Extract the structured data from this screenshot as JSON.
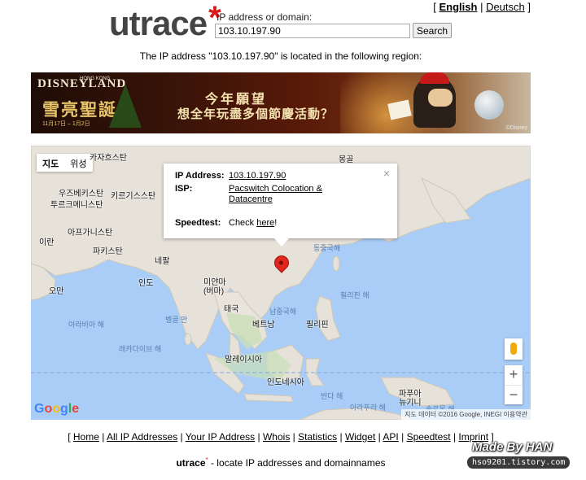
{
  "header": {
    "lang_open": "[ ",
    "lang_english": "English",
    "lang_sep": " | ",
    "lang_deutsch": "Deutsch",
    "lang_close": " ]",
    "logo": "utrace",
    "logo_star": "*",
    "ip_label": "IP address or domain:",
    "ip_value": "103.10.197.90",
    "search_button": "Search"
  },
  "located_text": "The IP address \"103.10.197.90\" is located in the following region:",
  "banner": {
    "brand": "DISNEYLAND",
    "brand_region": "HONG KONG",
    "title_left": "雪亮聖誕",
    "dates": "11月17日 – 1月2日",
    "line1": "今年願望",
    "line2": "想全年玩盡多個節慶活動？",
    "copyright": "©Disney"
  },
  "map": {
    "tab_map": "지도",
    "tab_satellite": "위성",
    "labels": [
      {
        "text": "카자흐스탄"
      },
      {
        "text": "몽골"
      },
      {
        "text": "우즈베키스탄"
      },
      {
        "text": "키르기스스탄"
      },
      {
        "text": "투르크메니스탄"
      },
      {
        "text": "아프가니스탄"
      },
      {
        "text": "이란"
      },
      {
        "text": "파키스탄"
      },
      {
        "text": "네팔"
      },
      {
        "text": "인도"
      },
      {
        "text": "오만"
      },
      {
        "text": "미얀마\n(버마)"
      },
      {
        "text": "태국"
      },
      {
        "text": "베트남"
      },
      {
        "text": "필리핀"
      },
      {
        "text": "말레이시아"
      },
      {
        "text": "인도네시아"
      },
      {
        "text": "파푸아\n뉴기니"
      }
    ],
    "seas": [
      {
        "text": "동중국해"
      },
      {
        "text": "필리핀 해"
      },
      {
        "text": "남중국해"
      },
      {
        "text": "벵골 만"
      },
      {
        "text": "아라비아 해"
      },
      {
        "text": "래카다이브 해"
      },
      {
        "text": "반다 해"
      },
      {
        "text": "아라푸라 해"
      },
      {
        "text": "솔로몬 해"
      }
    ],
    "popup": {
      "ip_label": "IP Address:",
      "ip_value": "103.10.197.90",
      "isp_label": "ISP:",
      "isp_value": "Pacswitch Colocation & Datacentre",
      "speedtest_label": "Speedtest:",
      "speedtest_prefix": "Check ",
      "speedtest_link": "here",
      "speedtest_suffix": "!",
      "close": "×"
    },
    "zoom_in": "+",
    "zoom_out": "−",
    "attribution": "지도 데이터 ©2016 Google, INEGI   이용약관"
  },
  "footer": {
    "open": "[ ",
    "links": [
      "Home",
      "All IP Addresses",
      "Your IP Address",
      "Whois",
      "Statistics",
      "Widget",
      "API",
      "Speedtest",
      "Imprint"
    ],
    "sep": " | ",
    "close": " ]"
  },
  "tagline": {
    "name": "utrace",
    "star": "*",
    "text": " - locate IP addresses and domainnames"
  },
  "watermark": {
    "made_by": "Made By HAN",
    "url": "hso9201.tistory.com"
  }
}
